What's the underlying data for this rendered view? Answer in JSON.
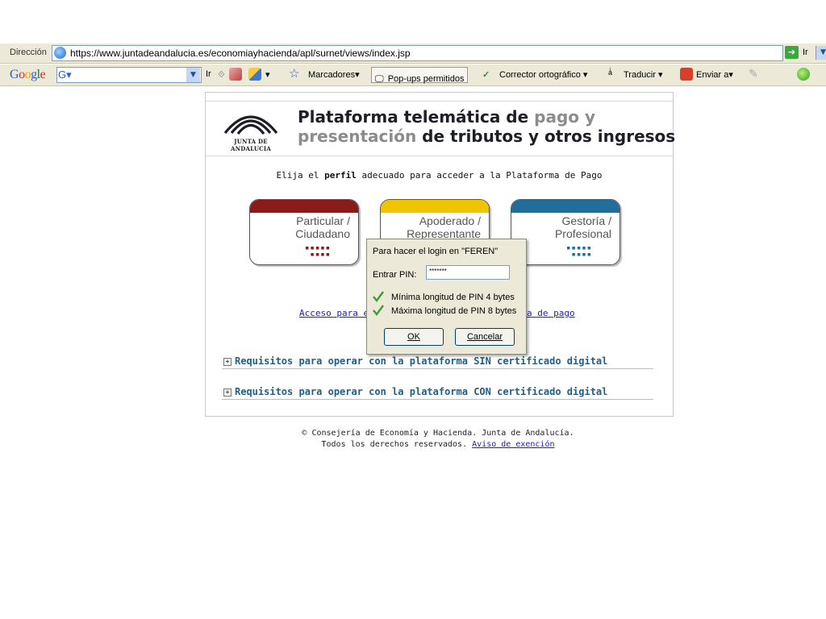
{
  "browser": {
    "address_label": "Dirección",
    "url": "https://www.juntadeandalucia.es/economiayhacienda/apl/surnet/views/index.jsp",
    "go_label": "Ir"
  },
  "google_toolbar": {
    "logo": "Google",
    "search_prefix": "G",
    "go_label": "Ir",
    "bookmarks_label": "Marcadores",
    "popups_label": "Pop-ups permitidos",
    "spellcheck_label": "Corrector ortográfico",
    "translate_label": "Traducir",
    "send_label": "Enviar a"
  },
  "page": {
    "logo_text": "JUNTA DE ANDALUCIA",
    "title_line1": {
      "part1": "Plataforma telemática de",
      "part2": "pago y"
    },
    "title_line2": {
      "part1": "presentación",
      "part2": "de tributos y otros ingresos"
    },
    "instruction": {
      "before": "Elija el",
      "bold": "perfil",
      "after": "adecuado para acceder a la Plataforma de Pago"
    },
    "cards": [
      {
        "line1": "Particular /",
        "line2": "Ciudadano",
        "color": "#8b1a1a"
      },
      {
        "line1": "Apoderado /",
        "line2": "Representante",
        "color": "#f0c400"
      },
      {
        "line1": "Gestoría /",
        "line2": "Profesional",
        "color": "#1f6e9c"
      }
    ],
    "access_link_left": "Acceso para e",
    "access_link_right": "a de pago",
    "requirements": [
      "Requisitos para operar con la plataforma SIN certificado digital",
      "Requisitos para operar con la plataforma CON certificado digital"
    ],
    "footer_line1": "© Consejería de Economía y Hacienda. Junta de Andalucía.",
    "footer_line2": "Todos los derechos reservados.",
    "footer_link": "Aviso de exención"
  },
  "dialog": {
    "title": "Para hacer el login en \"FEREN\"",
    "pin_label": "Entrar PIN:",
    "pin_value": "*******",
    "checks": [
      "Mínima longitud de PIN 4 bytes",
      "Máxima longitud de PIN 8 bytes"
    ],
    "ok_label": "OK",
    "cancel_label": "Cancelar"
  }
}
